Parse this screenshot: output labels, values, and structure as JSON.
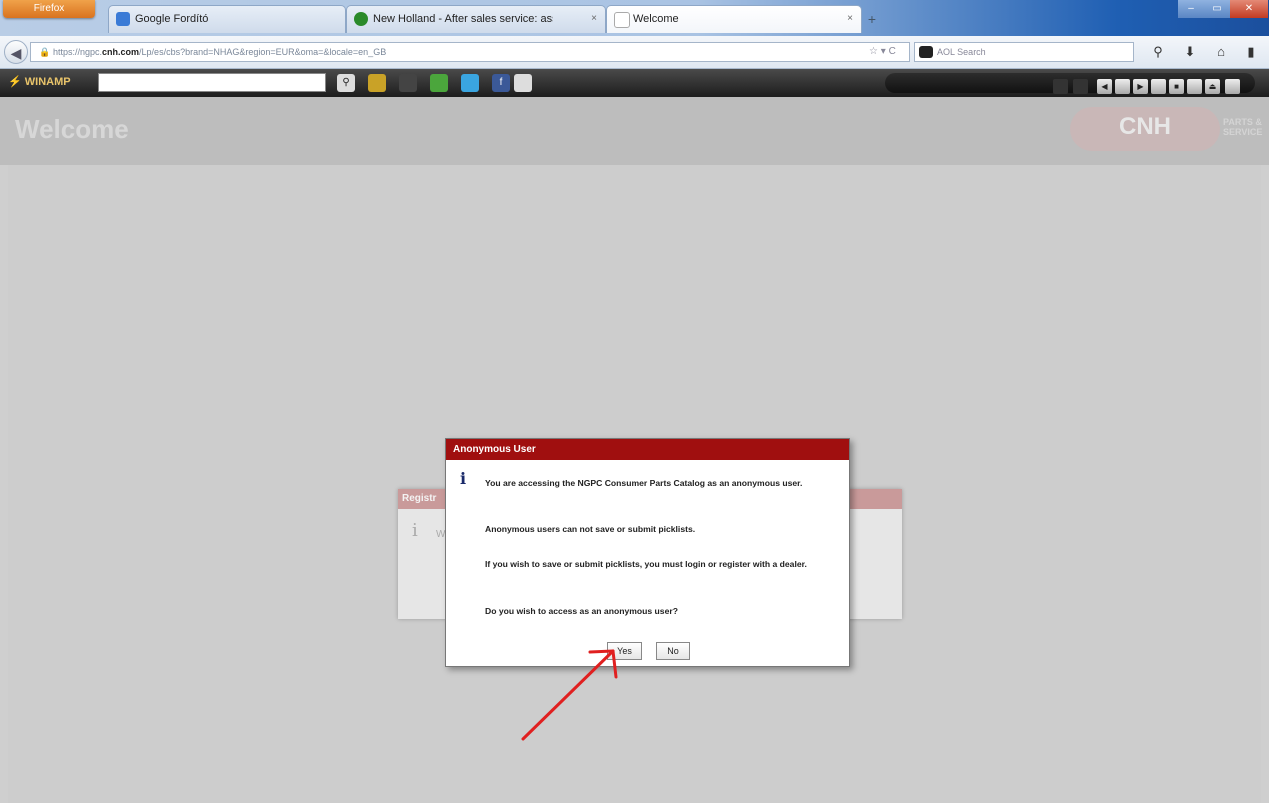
{
  "browser": {
    "menu_button": "Firefox",
    "tabs": [
      {
        "label": "Google Fordító",
        "active": false
      },
      {
        "label": "New Holland - After sales service: assi...",
        "active": false
      },
      {
        "label": "Welcome",
        "active": true
      }
    ],
    "new_tab": "+",
    "url": {
      "prefix": "https://ngpc.",
      "host": "cnh.com",
      "path": "/Lp/es/cbs?brand=NHAG&region=EUR&oma=&locale=en_GB"
    },
    "search_engine": "AOL Search"
  },
  "winamp": {
    "logo": "WINAMP"
  },
  "page": {
    "header_title": "Welcome",
    "logo": "CNH",
    "logo_sub": "PARTS & SERVICE"
  },
  "background_dialog": {
    "title": "Registr",
    "text": "W"
  },
  "dialog": {
    "title": "Anonymous User",
    "messages": [
      "You are accessing the NGPC Consumer Parts Catalog as an anonymous user.",
      "Anonymous users can not save or submit picklists.",
      "If you wish to save or submit picklists, you must login or register with a dealer.",
      "Do you wish to access as an anonymous user?"
    ],
    "yes_label": "Yes",
    "no_label": "No"
  },
  "colors": {
    "dialog_header": "#a00f0f",
    "annotation_arrow": "#e02020"
  }
}
